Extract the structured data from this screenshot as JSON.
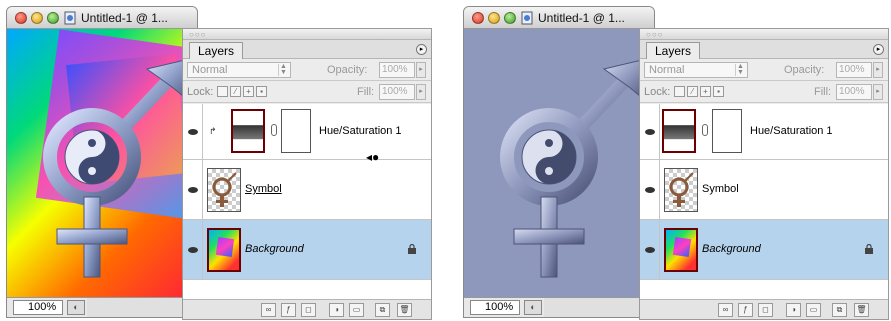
{
  "panels": [
    {
      "window_title": "Untitled-1 @ 1...",
      "zoom": "100%",
      "canvas": "rainbow",
      "layers_tab": "Layers",
      "blend_mode": "Normal",
      "opacity_label": "Opacity:",
      "opacity_value": "100%",
      "lock_label": "Lock:",
      "fill_label": "Fill:",
      "fill_value": "100%",
      "layers": [
        {
          "name": "Hue/Saturation 1",
          "kind": "adjustment",
          "selected": false
        },
        {
          "name": "Symbol",
          "kind": "symbol",
          "selected": false
        },
        {
          "name": "Background",
          "kind": "background",
          "selected": true
        }
      ]
    },
    {
      "window_title": "Untitled-1 @ 1...",
      "zoom": "100%",
      "canvas": "flat",
      "layers_tab": "Layers",
      "blend_mode": "Normal",
      "opacity_label": "Opacity:",
      "opacity_value": "100%",
      "lock_label": "Lock:",
      "fill_label": "Fill:",
      "fill_value": "100%",
      "layers": [
        {
          "name": "Hue/Saturation 1",
          "kind": "adjustment",
          "selected": false
        },
        {
          "name": "Symbol",
          "kind": "symbol",
          "selected": false
        },
        {
          "name": "Background",
          "kind": "background",
          "selected": true
        }
      ]
    }
  ],
  "colors": {
    "selected_row": "#b6d3ee",
    "flat_canvas": "#8e97bc",
    "symbol_metal": "#8f9fc8"
  },
  "icons": [
    "eye-icon",
    "chain-link-icon",
    "lock-icon",
    "palette-menu-icon",
    "trash-icon",
    "new-layer-icon",
    "folder-icon",
    "adjustment-icon",
    "mask-icon",
    "effects-icon",
    "link-icon",
    "pointer-cursor-icon"
  ]
}
